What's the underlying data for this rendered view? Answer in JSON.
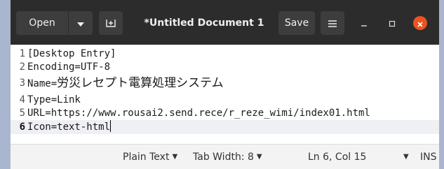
{
  "header": {
    "open_label": "Open",
    "title": "*Untitled Document 1",
    "save_label": "Save"
  },
  "editor": {
    "lines": [
      {
        "num": "1",
        "text": "[Desktop Entry]"
      },
      {
        "num": "2",
        "text": "Encoding=UTF-8"
      },
      {
        "num": "3",
        "prefix": "Name=",
        "text": "労災レセプト電算処理システム"
      },
      {
        "num": "4",
        "text": "Type=Link"
      },
      {
        "num": "5",
        "text": "URL=https://www.rousai2.send.rece/r_reze_wimi/index01.html"
      },
      {
        "num": "6",
        "text": "Icon=text-html"
      }
    ]
  },
  "status": {
    "language": "Plain Text",
    "tab_width": "Tab Width: 8",
    "position": "Ln 6, Col 15",
    "mode": "INS"
  },
  "colors": {
    "headerbar": "#2c2c2c",
    "close_button": "#e95420",
    "desktop": "#aab6cf"
  }
}
